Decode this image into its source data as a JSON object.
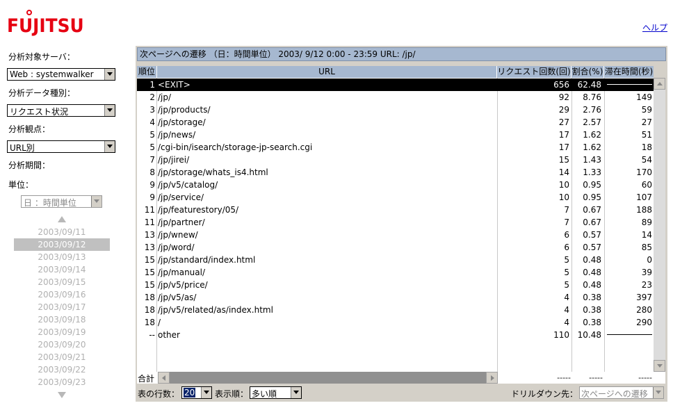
{
  "logo": "FUJITSU",
  "help_link": "ヘルプ",
  "sidebar": {
    "server_label": "分析対象サーバ：",
    "server_value": "Web : systemwalker",
    "datatype_label": "分析データ種別：",
    "datatype_value": "リクエスト状況",
    "viewpoint_label": "分析観点：",
    "viewpoint_value": "URL別",
    "period_label": "分析期間：",
    "unit_label": "単位：",
    "unit_value": "日 ：時間単位",
    "dates": [
      "2003/09/11",
      "2003/09/12",
      "2003/09/13",
      "2003/09/14",
      "2003/09/15",
      "2003/09/16",
      "2003/09/17",
      "2003/09/18",
      "2003/09/19",
      "2003/09/20",
      "2003/09/21",
      "2003/09/22",
      "2003/09/23"
    ],
    "selected_date": "2003/09/12"
  },
  "panel": {
    "title": "次ページへの遷移 （日：時間単位） 2003/ 9/12  0:00 - 23:59 URL: /jp/",
    "columns": {
      "rank": "順位",
      "url": "URL",
      "requests": "リクエスト回数(回)",
      "ratio": "割合(%)",
      "duration": "滞在時間(秒)"
    },
    "rows": [
      {
        "rank": "1",
        "url": "<EXIT>",
        "requests": "656",
        "ratio": "62.48",
        "duration": ""
      },
      {
        "rank": "2",
        "url": "/jp/",
        "requests": "92",
        "ratio": "8.76",
        "duration": "149"
      },
      {
        "rank": "3",
        "url": "/jp/products/",
        "requests": "29",
        "ratio": "2.76",
        "duration": "59"
      },
      {
        "rank": "4",
        "url": "/jp/storage/",
        "requests": "27",
        "ratio": "2.57",
        "duration": "27"
      },
      {
        "rank": "5",
        "url": "/jp/news/",
        "requests": "17",
        "ratio": "1.62",
        "duration": "51"
      },
      {
        "rank": "5",
        "url": "/cgi-bin/isearch/storage-jp-search.cgi",
        "requests": "17",
        "ratio": "1.62",
        "duration": "18"
      },
      {
        "rank": "7",
        "url": "/jp/jirei/",
        "requests": "15",
        "ratio": "1.43",
        "duration": "54"
      },
      {
        "rank": "8",
        "url": "/jp/storage/whats_is4.html",
        "requests": "14",
        "ratio": "1.33",
        "duration": "170"
      },
      {
        "rank": "9",
        "url": "/jp/v5/catalog/",
        "requests": "10",
        "ratio": "0.95",
        "duration": "60"
      },
      {
        "rank": "9",
        "url": "/jp/service/",
        "requests": "10",
        "ratio": "0.95",
        "duration": "107"
      },
      {
        "rank": "11",
        "url": "/jp/featurestory/05/",
        "requests": "7",
        "ratio": "0.67",
        "duration": "188"
      },
      {
        "rank": "11",
        "url": "/jp/partner/",
        "requests": "7",
        "ratio": "0.67",
        "duration": "89"
      },
      {
        "rank": "13",
        "url": "/jp/wnew/",
        "requests": "6",
        "ratio": "0.57",
        "duration": "14"
      },
      {
        "rank": "13",
        "url": "/jp/word/",
        "requests": "6",
        "ratio": "0.57",
        "duration": "85"
      },
      {
        "rank": "15",
        "url": "/jp/standard/index.html",
        "requests": "5",
        "ratio": "0.48",
        "duration": "0"
      },
      {
        "rank": "15",
        "url": "/jp/manual/",
        "requests": "5",
        "ratio": "0.48",
        "duration": "39"
      },
      {
        "rank": "15",
        "url": "/jp/v5/price/",
        "requests": "5",
        "ratio": "0.48",
        "duration": "23"
      },
      {
        "rank": "18",
        "url": "/jp/v5/as/",
        "requests": "4",
        "ratio": "0.38",
        "duration": "397"
      },
      {
        "rank": "18",
        "url": "/jp/v5/related/as/index.html",
        "requests": "4",
        "ratio": "0.38",
        "duration": "280"
      },
      {
        "rank": "18",
        "url": "/",
        "requests": "4",
        "ratio": "0.38",
        "duration": "290"
      },
      {
        "rank": "--",
        "url": "other",
        "requests": "110",
        "ratio": "10.48",
        "duration": ""
      }
    ],
    "total_label": "合計",
    "total_requests": "-----",
    "total_ratio": "-----",
    "total_duration": "-----"
  },
  "footer": {
    "rows_label": "表の行数：",
    "rows_value": "20",
    "order_label": "表示順：",
    "order_value": "多い順",
    "drill_label": "ドリルダウン先：",
    "drill_value": "次ページへの遷移"
  }
}
